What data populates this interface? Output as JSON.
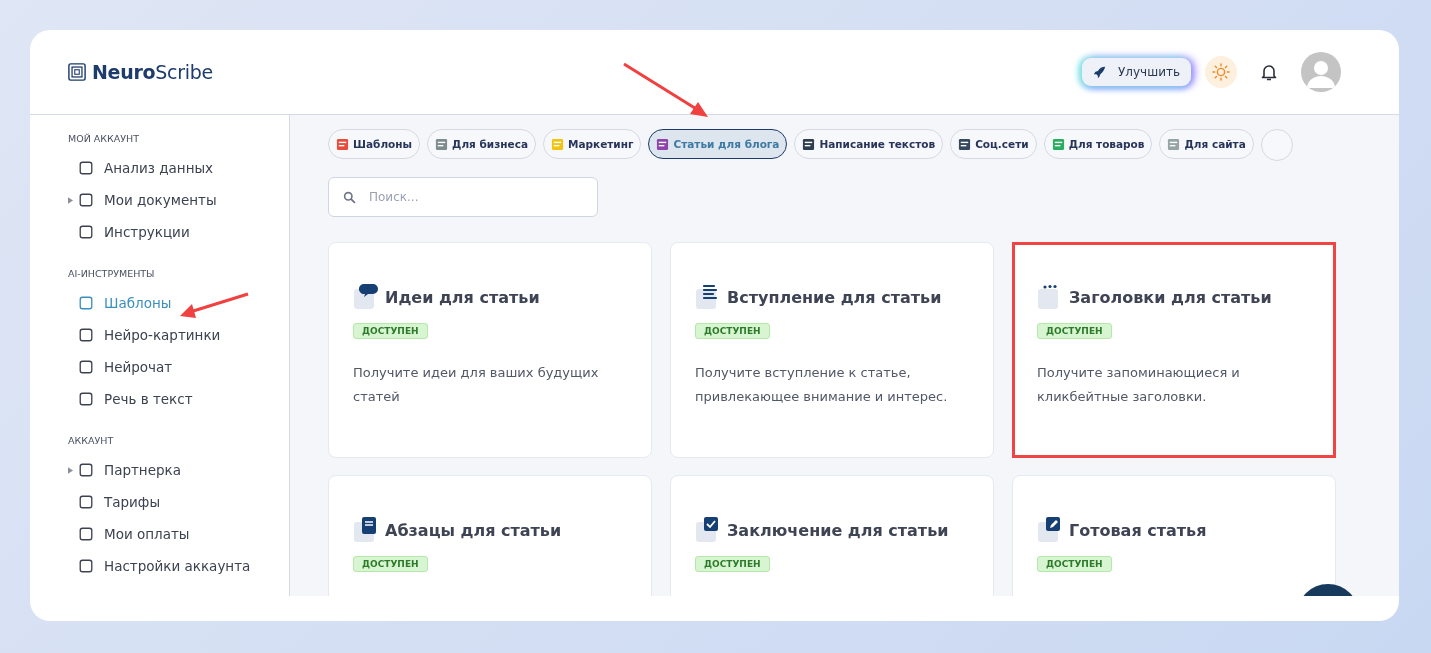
{
  "logo": {
    "bold": "Neuro",
    "light": "Scribe"
  },
  "header": {
    "upgrade_button": "Улучшить"
  },
  "sidebar": {
    "sections": [
      {
        "title": "МОЙ АККАУНТ",
        "items": [
          {
            "label": "Анализ данных",
            "kind": "link",
            "selected": false
          },
          {
            "label": "Мои документы",
            "kind": "group",
            "selected": false
          },
          {
            "label": "Инструкции",
            "kind": "link",
            "selected": false
          }
        ]
      },
      {
        "title": "AI-ИНСТРУМЕНТЫ",
        "items": [
          {
            "label": "Шаблоны",
            "kind": "link",
            "selected": true
          },
          {
            "label": "Нейро-картинки",
            "kind": "link",
            "selected": false
          },
          {
            "label": "Нейрочат",
            "kind": "link",
            "selected": false
          },
          {
            "label": "Речь в текст",
            "kind": "link",
            "selected": false
          }
        ]
      },
      {
        "title": "АККАУНТ",
        "items": [
          {
            "label": "Партнерка",
            "kind": "group",
            "selected": false
          },
          {
            "label": "Тарифы",
            "kind": "link",
            "selected": false
          },
          {
            "label": "Мои оплаты",
            "kind": "link",
            "selected": false
          },
          {
            "label": "Настройки аккаунта",
            "kind": "link",
            "selected": false
          }
        ]
      }
    ]
  },
  "categories": [
    {
      "label": "Шаблоны",
      "selected": false
    },
    {
      "label": "Для бизнеса",
      "selected": false
    },
    {
      "label": "Маркетинг",
      "selected": false
    },
    {
      "label": "Статьи для блога",
      "selected": true
    },
    {
      "label": "Написание текстов",
      "selected": false
    },
    {
      "label": "Соц.сети",
      "selected": false
    },
    {
      "label": "Для товаров",
      "selected": false
    },
    {
      "label": "Для сайта",
      "selected": false
    }
  ],
  "search": {
    "placeholder": "Поиск..."
  },
  "templates": [
    {
      "title": "Идеи для статьи",
      "badge": "ДОСТУПЕН",
      "description": "Получите идеи для ваших будущих статей",
      "highlighted": false
    },
    {
      "title": "Вступление для статьи",
      "badge": "ДОСТУПЕН",
      "description": "Получите вступление к статье, привлекающее внимание и интерес.",
      "highlighted": false
    },
    {
      "title": "Заголовки для статьи",
      "badge": "ДОСТУПЕН",
      "description": "Получите запоминающиеся и кликбейтные заголовки.",
      "highlighted": true
    },
    {
      "title": "Абзацы для статьи",
      "badge": "ДОСТУПЕН",
      "highlighted": false
    },
    {
      "title": "Заключение для статьи",
      "badge": "ДОСТУПЕН",
      "highlighted": false
    },
    {
      "title": "Готовая статья",
      "badge": "ДОСТУПЕН",
      "highlighted": false
    }
  ]
}
